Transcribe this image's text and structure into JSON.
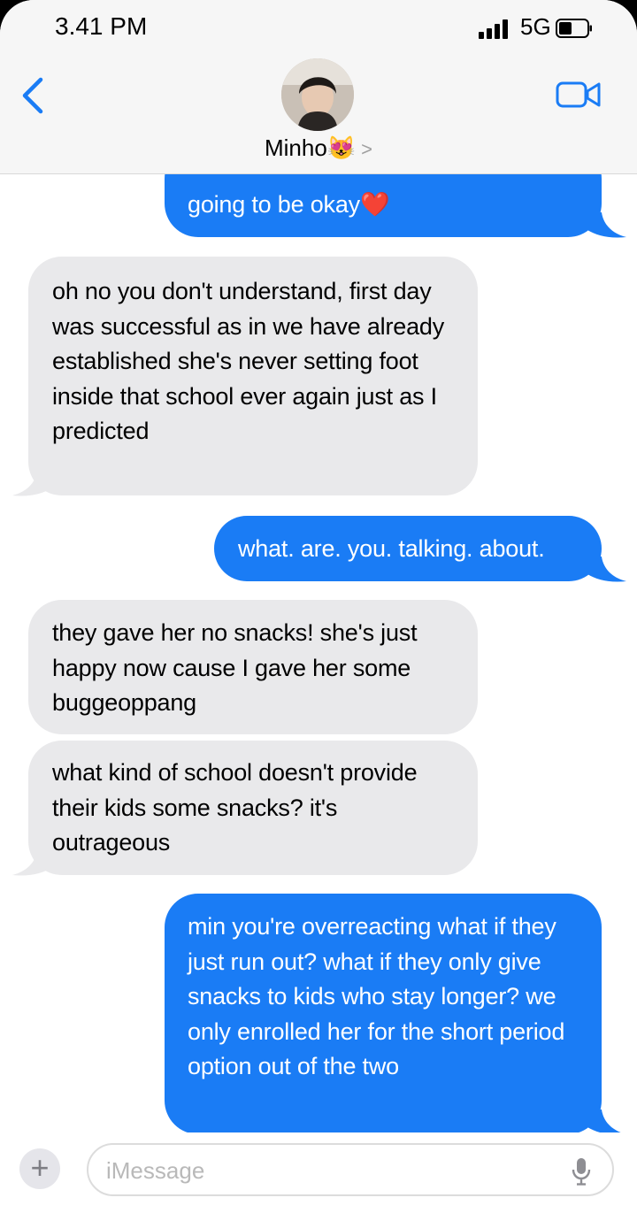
{
  "status_bar": {
    "time": "3.41 PM",
    "network": "5G"
  },
  "header": {
    "contact_name": "Minho😻",
    "chevron": ">"
  },
  "messages": [
    {
      "from": "me",
      "text": "going to be okay❤️"
    },
    {
      "from": "them",
      "text": "oh no you don't understand, first day was successful as in we have already established she's never setting foot inside that school ever again just as I predicted"
    },
    {
      "from": "me",
      "text": "what. are. you. talking. about."
    },
    {
      "from": "them",
      "text": "they gave her no snacks! she's just happy now cause I gave her some buggeoppang"
    },
    {
      "from": "them",
      "text": "what kind of school doesn't provide their kids some snacks? it's outrageous"
    },
    {
      "from": "me",
      "text": "min you're overreacting what if they just run out? what if they only give snacks to kids who stay longer? we only enrolled her for the short period option out of the two"
    }
  ],
  "composer": {
    "placeholder": "iMessage",
    "add_label": "+"
  },
  "colors": {
    "sent_bubble": "#1a7cf5",
    "received_bubble": "#e9e9eb",
    "accent": "#1a7cf5"
  }
}
